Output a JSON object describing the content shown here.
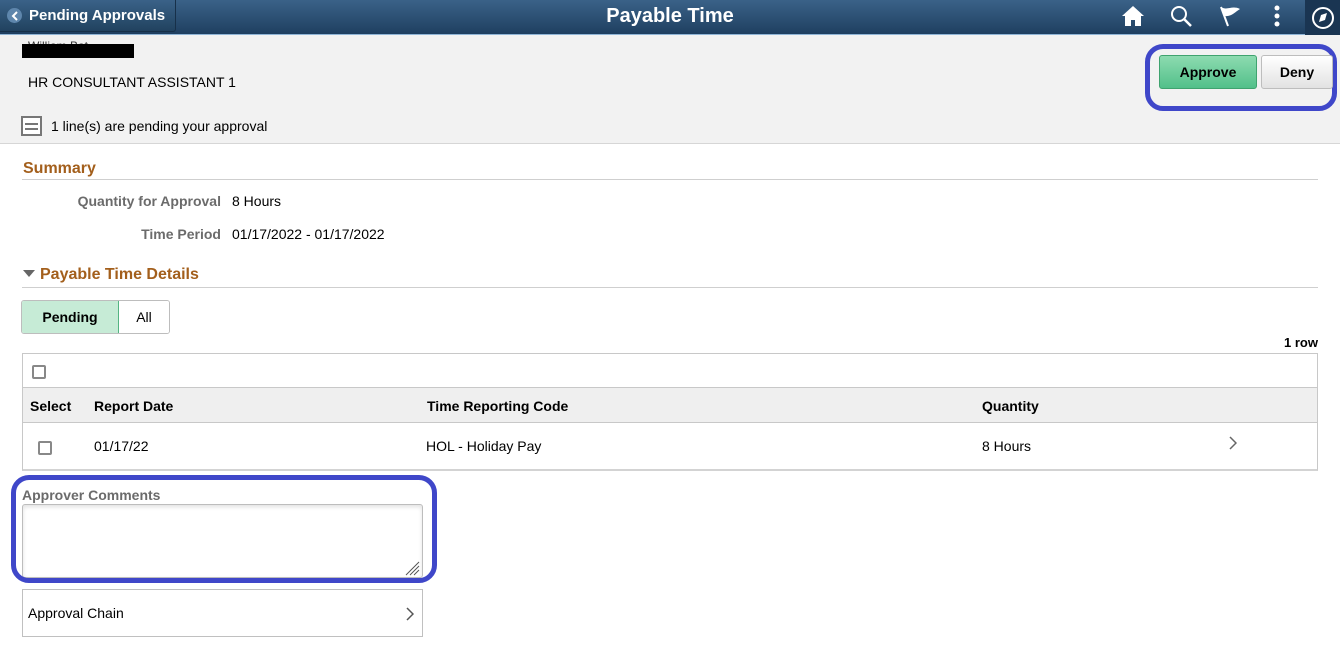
{
  "banner": {
    "back_label": "Pending Approvals",
    "title": "Payable Time",
    "icons": [
      "home-icon",
      "search-icon",
      "flag-icon",
      "more-icon",
      "navbar-compass-icon"
    ]
  },
  "header": {
    "employee_name_peek": "William Bat",
    "job_title": "HR CONSULTANT ASSISTANT 1",
    "pending_message": "1 line(s) are pending your approval",
    "approve_label": "Approve",
    "deny_label": "Deny"
  },
  "summary": {
    "title": "Summary",
    "fields": [
      {
        "label": "Quantity for Approval",
        "value": "8 Hours"
      },
      {
        "label": "Time Period",
        "value": "01/17/2022 - 01/17/2022"
      }
    ]
  },
  "details": {
    "title": "Payable Time Details",
    "segments": [
      {
        "label": "Pending",
        "selected": true
      },
      {
        "label": "All",
        "selected": false
      }
    ],
    "row_count": "1 row",
    "columns": [
      "Select",
      "Report Date",
      "Time Reporting Code",
      "Quantity"
    ],
    "rows": [
      {
        "report_date": "01/17/22",
        "trc": "HOL - Holiday Pay",
        "quantity": "8 Hours",
        "selected": false
      }
    ]
  },
  "comments": {
    "label": "Approver Comments",
    "value": ""
  },
  "approval_chain": {
    "label": "Approval Chain"
  },
  "colors": {
    "banner": "#2b4f73",
    "section_title": "#a35f1c",
    "approve": "#5ec692",
    "annotation": "#3f47c9"
  }
}
